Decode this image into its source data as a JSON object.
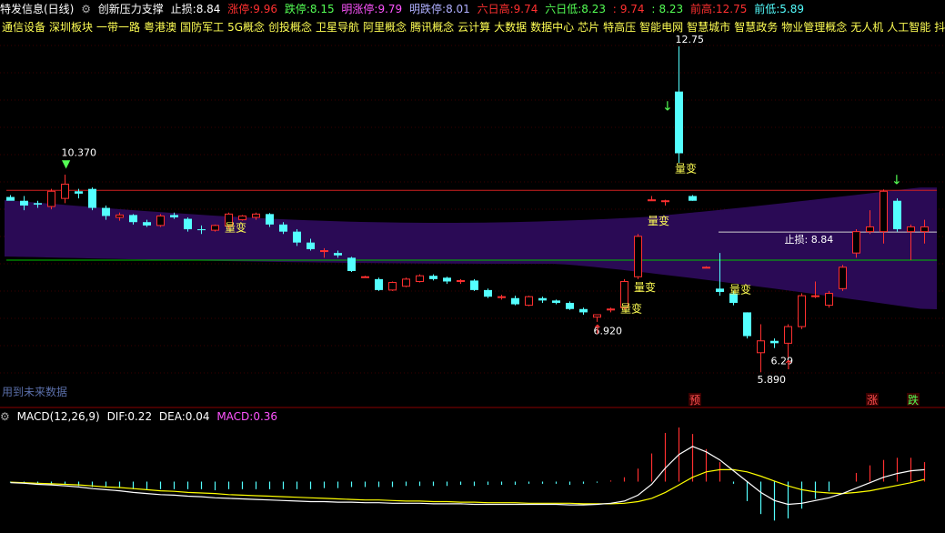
{
  "header": {
    "title": "特发信息(日线)",
    "indicator": "创新压力支撑",
    "stop_loss_label": "止损:",
    "stop_loss": "8.84",
    "limit_up_label": "涨停:",
    "limit_up": "9.96",
    "limit_down_label": "跌停:",
    "limit_down": "8.15",
    "next_limit_up_label": "明涨停:",
    "next_limit_up": "9.79",
    "next_limit_down_label": "明跌停:",
    "next_limit_down": "8.01",
    "six_high_label": "六日高:",
    "six_high": "9.74",
    "six_low_label": "六日低:",
    "six_low": "8.23",
    "six_low_sep": ":",
    "six_low_v2": "9.74",
    "six_low_v3": "8.23",
    "prev_high_label": "前高:",
    "prev_high": "12.75",
    "prev_low_label": "前低:",
    "prev_low": "5.89"
  },
  "concepts": [
    "通信设备",
    "深圳板块",
    "一带一路",
    "粤港澳",
    "国防军工",
    "5G概念",
    "创投概念",
    "卫星导航",
    "阿里概念",
    "腾讯概念",
    "云计算",
    "大数据",
    "数据中心",
    "芯片",
    "特高压",
    "智能电网",
    "智慧城市",
    "智慧政务",
    "物业管理概念",
    "无人机",
    "人工智能",
    "抖音概念"
  ],
  "future_label": "用到未来数据",
  "macd_header": {
    "name": "MACD(12,26,9)",
    "dif_label": "DIF:",
    "dif": "0.22",
    "dea_label": "DEA:",
    "dea": "0.04",
    "macd_label": "MACD:",
    "macd": "0.36"
  },
  "colors": {
    "up": "#ff3030",
    "down": "#54ffff",
    "band": "#2a0a55",
    "green_line": "#00c000",
    "red_line": "#d02020",
    "white": "#ffffff",
    "yellow": "#ffff54",
    "magenta": "#ff54ff",
    "dif": "#ffffff",
    "dea": "#ffff00",
    "hist_up": "#ff3030",
    "hist_down": "#54ffff"
  },
  "chart_data": [
    {
      "type": "candlestick",
      "title": "",
      "ylim": [
        5.3,
        13.0
      ],
      "candles": [
        {
          "o": 9.58,
          "h": 9.62,
          "l": 9.52,
          "c": 9.5
        },
        {
          "o": 9.5,
          "h": 9.6,
          "l": 9.3,
          "c": 9.4
        },
        {
          "o": 9.45,
          "h": 9.5,
          "l": 9.35,
          "c": 9.42
        },
        {
          "o": 9.38,
          "h": 9.75,
          "l": 9.32,
          "c": 9.7
        },
        {
          "o": 9.55,
          "h": 10.05,
          "l": 9.45,
          "c": 9.85
        },
        {
          "o": 9.7,
          "h": 9.75,
          "l": 9.55,
          "c": 9.65
        },
        {
          "o": 9.75,
          "h": 9.78,
          "l": 9.3,
          "c": 9.35
        },
        {
          "o": 9.35,
          "h": 9.4,
          "l": 9.1,
          "c": 9.18
        },
        {
          "o": 9.15,
          "h": 9.25,
          "l": 9.08,
          "c": 9.2
        },
        {
          "o": 9.2,
          "h": 9.22,
          "l": 9.0,
          "c": 9.05
        },
        {
          "o": 9.05,
          "h": 9.1,
          "l": 8.95,
          "c": 8.98
        },
        {
          "o": 8.98,
          "h": 9.22,
          "l": 8.95,
          "c": 9.18
        },
        {
          "o": 9.2,
          "h": 9.25,
          "l": 9.12,
          "c": 9.15
        },
        {
          "o": 9.12,
          "h": 9.15,
          "l": 8.85,
          "c": 8.9
        },
        {
          "o": 8.9,
          "h": 8.98,
          "l": 8.8,
          "c": 8.88
        },
        {
          "o": 8.88,
          "h": 9.0,
          "l": 8.85,
          "c": 8.98
        },
        {
          "o": 8.97,
          "h": 9.25,
          "l": 8.9,
          "c": 9.22
        },
        {
          "o": 9.1,
          "h": 9.2,
          "l": 9.08,
          "c": 9.18
        },
        {
          "o": 9.15,
          "h": 9.25,
          "l": 9.1,
          "c": 9.22
        },
        {
          "o": 9.22,
          "h": 9.24,
          "l": 8.95,
          "c": 9.0
        },
        {
          "o": 9.0,
          "h": 9.05,
          "l": 8.8,
          "c": 8.85
        },
        {
          "o": 8.85,
          "h": 8.9,
          "l": 8.55,
          "c": 8.62
        },
        {
          "o": 8.62,
          "h": 8.7,
          "l": 8.45,
          "c": 8.48
        },
        {
          "o": 8.45,
          "h": 8.5,
          "l": 8.3,
          "c": 8.45
        },
        {
          "o": 8.4,
          "h": 8.45,
          "l": 8.3,
          "c": 8.35
        },
        {
          "o": 8.3,
          "h": 8.32,
          "l": 8.0,
          "c": 8.02
        },
        {
          "o": 7.9,
          "h": 7.92,
          "l": 7.88,
          "c": 7.9
        },
        {
          "o": 7.85,
          "h": 7.88,
          "l": 7.6,
          "c": 7.62
        },
        {
          "o": 7.62,
          "h": 7.8,
          "l": 7.6,
          "c": 7.78
        },
        {
          "o": 7.7,
          "h": 7.88,
          "l": 7.68,
          "c": 7.85
        },
        {
          "o": 7.8,
          "h": 7.95,
          "l": 7.78,
          "c": 7.92
        },
        {
          "o": 7.92,
          "h": 7.95,
          "l": 7.82,
          "c": 7.85
        },
        {
          "o": 7.88,
          "h": 7.9,
          "l": 7.75,
          "c": 7.8
        },
        {
          "o": 7.8,
          "h": 7.85,
          "l": 7.75,
          "c": 7.82
        },
        {
          "o": 7.82,
          "h": 7.85,
          "l": 7.6,
          "c": 7.62
        },
        {
          "o": 7.62,
          "h": 7.65,
          "l": 7.45,
          "c": 7.48
        },
        {
          "o": 7.48,
          "h": 7.52,
          "l": 7.42,
          "c": 7.48
        },
        {
          "o": 7.45,
          "h": 7.5,
          "l": 7.3,
          "c": 7.32
        },
        {
          "o": 7.3,
          "h": 7.5,
          "l": 7.28,
          "c": 7.48
        },
        {
          "o": 7.45,
          "h": 7.48,
          "l": 7.35,
          "c": 7.4
        },
        {
          "o": 7.4,
          "h": 7.42,
          "l": 7.32,
          "c": 7.35
        },
        {
          "o": 7.35,
          "h": 7.38,
          "l": 7.2,
          "c": 7.22
        },
        {
          "o": 7.22,
          "h": 7.25,
          "l": 7.1,
          "c": 7.15
        },
        {
          "o": 7.05,
          "h": 7.1,
          "l": 6.95,
          "c": 7.1
        },
        {
          "o": 7.2,
          "h": 7.25,
          "l": 7.15,
          "c": 7.22
        },
        {
          "o": 7.25,
          "h": 7.85,
          "l": 7.2,
          "c": 7.8
        },
        {
          "o": 7.9,
          "h": 8.8,
          "l": 7.85,
          "c": 8.75
        },
        {
          "o": 9.5,
          "h": 9.6,
          "l": 9.5,
          "c": 9.52
        },
        {
          "o": 9.5,
          "h": 9.52,
          "l": 9.4,
          "c": 9.5
        },
        {
          "o": 11.8,
          "h": 12.75,
          "l": 10.3,
          "c": 10.5
        },
        {
          "o": 9.6,
          "h": 9.62,
          "l": 9.5,
          "c": 9.5
        },
        {
          "o": 8.1,
          "h": 8.12,
          "l": 8.08,
          "c": 8.1
        },
        {
          "o": 7.65,
          "h": 8.4,
          "l": 7.5,
          "c": 7.58
        },
        {
          "o": 7.55,
          "h": 7.6,
          "l": 7.3,
          "c": 7.35
        },
        {
          "o": 7.15,
          "h": 7.15,
          "l": 6.6,
          "c": 6.65
        },
        {
          "o": 6.3,
          "h": 6.9,
          "l": 5.89,
          "c": 6.55
        },
        {
          "o": 6.55,
          "h": 6.6,
          "l": 6.4,
          "c": 6.5
        },
        {
          "o": 6.5,
          "h": 6.9,
          "l": 6.2,
          "c": 6.85
        },
        {
          "o": 6.85,
          "h": 7.55,
          "l": 6.8,
          "c": 7.5
        },
        {
          "o": 7.5,
          "h": 7.8,
          "l": 7.45,
          "c": 7.5
        },
        {
          "o": 7.3,
          "h": 7.6,
          "l": 7.25,
          "c": 7.55
        },
        {
          "o": 7.65,
          "h": 8.15,
          "l": 7.6,
          "c": 8.1
        },
        {
          "o": 8.4,
          "h": 8.9,
          "l": 8.3,
          "c": 8.85
        },
        {
          "o": 8.85,
          "h": 9.3,
          "l": 8.8,
          "c": 8.95
        },
        {
          "o": 8.85,
          "h": 9.74,
          "l": 8.6,
          "c": 9.7
        },
        {
          "o": 9.5,
          "h": 9.55,
          "l": 8.85,
          "c": 8.9
        },
        {
          "o": 8.85,
          "h": 9.0,
          "l": 8.25,
          "c": 8.95
        },
        {
          "o": 8.85,
          "h": 9.1,
          "l": 8.6,
          "c": 8.95
        }
      ],
      "markers": [
        {
          "text": "10.370",
          "i": 4,
          "v": 10.37
        },
        {
          "text": "12.75",
          "i": 49,
          "v": 12.75
        },
        {
          "text": "6.920",
          "i": 43,
          "v": 6.92
        },
        {
          "text": "5.890",
          "i": 55,
          "v": 5.89
        },
        {
          "text": "6.29",
          "i": 56,
          "v": 6.29
        },
        {
          "text": "止损: 8.84",
          "i": 57,
          "v": 8.84
        }
      ],
      "tags": [
        {
          "text": "量变",
          "i": 16,
          "v": 8.85
        },
        {
          "text": "量变",
          "i": 47,
          "v": 9.0
        },
        {
          "text": "量变",
          "i": 49,
          "v": 10.1
        },
        {
          "text": "量变",
          "i": 46,
          "v": 7.6
        },
        {
          "text": "量变",
          "i": 45,
          "v": 7.15
        },
        {
          "text": "量变",
          "i": 53,
          "v": 7.55
        }
      ],
      "badges": [
        {
          "text": "预",
          "i": 50
        },
        {
          "text": "涨",
          "i": 63
        },
        {
          "text": "跌",
          "i": 66
        }
      ],
      "red_line_value": 9.72,
      "green_line_value": 8.25,
      "stop_loss_value": 8.84
    },
    {
      "type": "macd",
      "title": "MACD(12,26,9)",
      "ylim": [
        -0.95,
        1.0
      ],
      "dif": [
        -0.02,
        -0.03,
        -0.05,
        -0.06,
        -0.08,
        -0.1,
        -0.13,
        -0.15,
        -0.17,
        -0.2,
        -0.22,
        -0.24,
        -0.25,
        -0.27,
        -0.28,
        -0.3,
        -0.31,
        -0.32,
        -0.33,
        -0.34,
        -0.35,
        -0.36,
        -0.37,
        -0.37,
        -0.38,
        -0.38,
        -0.39,
        -0.39,
        -0.4,
        -0.4,
        -0.4,
        -0.41,
        -0.41,
        -0.41,
        -0.42,
        -0.42,
        -0.42,
        -0.42,
        -0.42,
        -0.42,
        -0.42,
        -0.43,
        -0.43,
        -0.42,
        -0.4,
        -0.36,
        -0.25,
        -0.05,
        0.25,
        0.5,
        0.65,
        0.55,
        0.4,
        0.2,
        0.0,
        -0.2,
        -0.35,
        -0.42,
        -0.4,
        -0.35,
        -0.3,
        -0.22,
        -0.12,
        -0.02,
        0.08,
        0.15,
        0.2,
        0.22
      ],
      "dea": [
        -0.01,
        -0.02,
        -0.03,
        -0.04,
        -0.05,
        -0.06,
        -0.08,
        -0.1,
        -0.11,
        -0.13,
        -0.15,
        -0.17,
        -0.18,
        -0.2,
        -0.21,
        -0.22,
        -0.24,
        -0.25,
        -0.26,
        -0.27,
        -0.28,
        -0.29,
        -0.3,
        -0.31,
        -0.32,
        -0.33,
        -0.34,
        -0.34,
        -0.35,
        -0.36,
        -0.36,
        -0.37,
        -0.37,
        -0.38,
        -0.38,
        -0.39,
        -0.39,
        -0.39,
        -0.4,
        -0.4,
        -0.4,
        -0.4,
        -0.41,
        -0.41,
        -0.41,
        -0.4,
        -0.37,
        -0.31,
        -0.2,
        -0.06,
        0.08,
        0.18,
        0.22,
        0.22,
        0.18,
        0.1,
        0.01,
        -0.08,
        -0.15,
        -0.19,
        -0.21,
        -0.22,
        -0.2,
        -0.17,
        -0.12,
        -0.07,
        -0.02,
        0.04
      ],
      "macd": [
        -0.02,
        -0.02,
        -0.04,
        -0.04,
        -0.06,
        -0.08,
        -0.1,
        -0.1,
        -0.12,
        -0.14,
        -0.14,
        -0.14,
        -0.14,
        -0.14,
        -0.14,
        -0.16,
        -0.14,
        -0.14,
        -0.14,
        -0.14,
        -0.14,
        -0.14,
        -0.14,
        -0.12,
        -0.12,
        -0.1,
        -0.1,
        -0.1,
        -0.1,
        -0.08,
        -0.08,
        -0.08,
        -0.08,
        -0.06,
        -0.08,
        -0.06,
        -0.06,
        -0.06,
        -0.04,
        -0.04,
        -0.04,
        -0.06,
        -0.04,
        -0.02,
        0.02,
        0.08,
        0.24,
        0.52,
        0.9,
        1.0,
        0.88,
        0.6,
        0.36,
        -0.04,
        -0.36,
        -0.6,
        -0.72,
        -0.68,
        -0.5,
        -0.32,
        -0.18,
        0.0,
        0.16,
        0.3,
        0.4,
        0.44,
        0.44,
        0.36
      ]
    }
  ]
}
